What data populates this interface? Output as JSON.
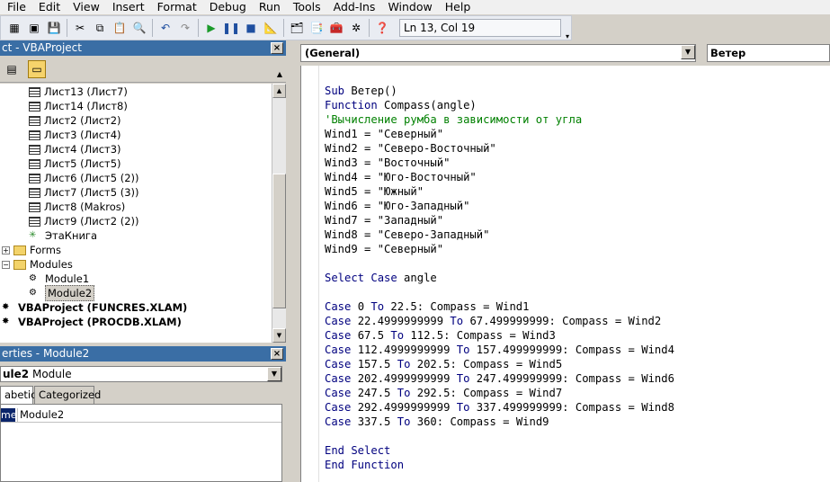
{
  "menu": [
    "File",
    "Edit",
    "View",
    "Insert",
    "Format",
    "Debug",
    "Run",
    "Tools",
    "Add-Ins",
    "Window",
    "Help"
  ],
  "toolbar": {
    "position": "Ln 13, Col 19"
  },
  "project": {
    "title": "ct - VBAProject",
    "tree": [
      {
        "label": "Лист13 (Лист7)",
        "kind": "sheet"
      },
      {
        "label": "Лист14 (Лист8)",
        "kind": "sheet"
      },
      {
        "label": "Лист2 (Лист2)",
        "kind": "sheet"
      },
      {
        "label": "Лист3 (Лист4)",
        "kind": "sheet"
      },
      {
        "label": "Лист4 (Лист3)",
        "kind": "sheet"
      },
      {
        "label": "Лист5 (Лист5)",
        "kind": "sheet"
      },
      {
        "label": "Лист6 (Лист5 (2))",
        "kind": "sheet"
      },
      {
        "label": "Лист7 (Лист5 (3))",
        "kind": "sheet"
      },
      {
        "label": "Лист8 (Makros)",
        "kind": "sheet"
      },
      {
        "label": "Лист9 (Лист2 (2))",
        "kind": "sheet"
      },
      {
        "label": "ЭтаКнига",
        "kind": "workbook"
      },
      {
        "label": "Forms",
        "kind": "folder"
      },
      {
        "label": "Modules",
        "kind": "folder-open"
      },
      {
        "label": "Module1",
        "kind": "module"
      },
      {
        "label": "Module2",
        "kind": "module"
      },
      {
        "label": "VBAProject (FUNCRES.XLAM)",
        "kind": "project"
      },
      {
        "label": "VBAProject (PROCDB.XLAM)",
        "kind": "project"
      }
    ]
  },
  "properties": {
    "title": "erties - Module2",
    "combo_name": "ule2",
    "combo_type": "Module",
    "tabs": [
      "abetic",
      "Categorized"
    ],
    "row_name": "me)",
    "row_value": "Module2"
  },
  "code": {
    "object_combo": "(General)",
    "proc_combo": "Ветер",
    "lines": [
      {
        "t": "Sub Ветер()",
        "k": "kw-start"
      },
      {
        "t": "Function Compass(angle)",
        "k": "kw-start"
      },
      {
        "t": "'Вычисление румба в зависимости от угла",
        "k": "comment"
      },
      {
        "t": "Wind1 = \"Северный\"",
        "k": "plain"
      },
      {
        "t": "Wind2 = \"Северо-Восточный\"",
        "k": "plain"
      },
      {
        "t": "Wind3 = \"Восточный\"",
        "k": "plain"
      },
      {
        "t": "Wind4 = \"Юго-Восточный\"",
        "k": "plain"
      },
      {
        "t": "Wind5 = \"Южный\"",
        "k": "plain"
      },
      {
        "t": "Wind6 = \"Юго-Западный\"",
        "k": "plain"
      },
      {
        "t": "Wind7 = \"Западный\"",
        "k": "plain"
      },
      {
        "t": "Wind8 = \"Северо-Западный\"",
        "k": "plain"
      },
      {
        "t": "Wind9 = \"Северный\"",
        "k": "plain"
      },
      {
        "t": "",
        "k": "plain"
      },
      {
        "t": "Select Case angle",
        "k": "select"
      },
      {
        "t": "",
        "k": "plain"
      },
      {
        "t": "Case 0 To 22.5: Compass = Wind1",
        "k": "case"
      },
      {
        "t": "Case 22.4999999999 To 67.499999999: Compass = Wind2",
        "k": "case"
      },
      {
        "t": "Case 67.5 To 112.5: Compass = Wind3",
        "k": "case"
      },
      {
        "t": "Case 112.4999999999 To 157.499999999: Compass = Wind4",
        "k": "case"
      },
      {
        "t": "Case 157.5 To 202.5: Compass = Wind5",
        "k": "case"
      },
      {
        "t": "Case 202.4999999999 To 247.499999999: Compass = Wind6",
        "k": "case"
      },
      {
        "t": "Case 247.5 To 292.5: Compass = Wind7",
        "k": "case"
      },
      {
        "t": "Case 292.4999999999 To 337.499999999: Compass = Wind8",
        "k": "case"
      },
      {
        "t": "Case 337.5 To 360: Compass = Wind9",
        "k": "case"
      },
      {
        "t": "",
        "k": "plain"
      },
      {
        "t": "End Select",
        "k": "kw-all"
      },
      {
        "t": "End Function",
        "k": "kw-all"
      }
    ]
  }
}
